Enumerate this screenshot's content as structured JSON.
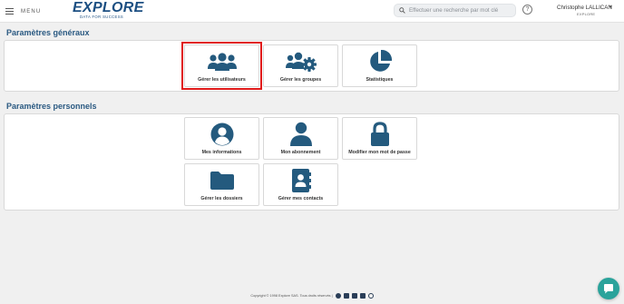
{
  "header": {
    "menu_label": "MENU",
    "logo_text": "EXPLORE",
    "logo_tagline": "DATA FOR SUCCESS",
    "search_placeholder": "Effectuer une recherche par mot clé",
    "help_label": "?",
    "user_name": "Christophe LALLICAN",
    "user_org": "EXPLORE",
    "user_caret": "▾"
  },
  "sections": {
    "general": {
      "title": "Paramètres généraux",
      "tiles": [
        {
          "label": "Gérer les utilisateurs",
          "icon": "users-icon"
        },
        {
          "label": "Gérer les groupes",
          "icon": "users-gear-icon"
        },
        {
          "label": "Statistiques",
          "icon": "pie-chart-icon"
        }
      ]
    },
    "personal": {
      "title": "Paramètres personnels",
      "tiles": [
        {
          "label": "Mes informations",
          "icon": "user-circle-icon"
        },
        {
          "label": "Mon abonnement",
          "icon": "user-icon"
        },
        {
          "label": "Modifier mon mot de passe",
          "icon": "lock-icon"
        },
        {
          "label": "Gérer les dossiers",
          "icon": "folder-icon"
        },
        {
          "label": "Gérer mes contacts",
          "icon": "address-book-icon"
        }
      ]
    }
  },
  "footer": {
    "copyright": "Copyright © 1998 Explore SAS. Tous droits réservés |"
  },
  "colors": {
    "brand": "#1c4f82",
    "icon": "#245a7e",
    "section_title": "#2b5a82",
    "highlight": "#e01b1b",
    "chat": "#2aa39b"
  }
}
